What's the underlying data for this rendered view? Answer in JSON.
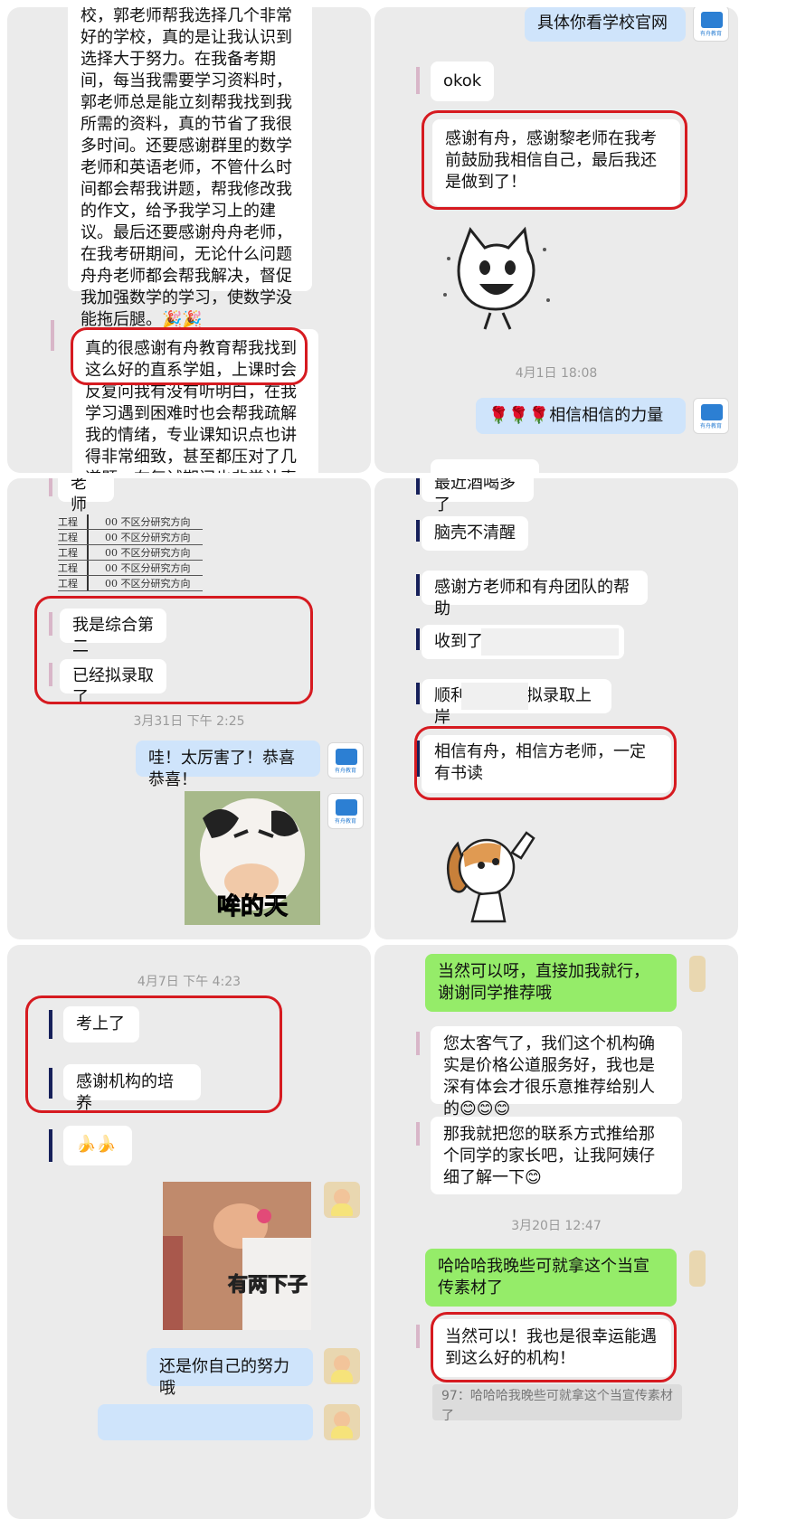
{
  "panels": {
    "p1": {
      "msg1": "校，郭老师帮我选择几个非常好的学校，真的是让我认识到选择大于努力。在我备考期间，每当我需要学习资料时，郭老师总是能立刻帮我找到我所需的资料，真的节省了我很多时间。还要感谢群里的数学老师和英语老师，不管什么时间都会帮我讲题，帮我修改我的作文，给予我学习上的建议。最后还要感谢舟舟老师，在我考研期间，无论什么问题舟舟老师都会帮我解决，督促我加强数学的学习，使数学没能拖后腿。🎉🎉",
      "msg2": "真的很感谢有舟教育帮我找到这么好的直系学姐，上课时会反复问我有没有听明白，在我学习遇到困难时也会帮我疏解我的情绪，专业课知识点也讲得非常细致，甚至都压对了几道题。在复试期间也非常认真"
    },
    "p2": {
      "msg1": "具体你看学校官网",
      "msg2": "okok",
      "msg3": "感谢有舟，感谢黎老师在我考前鼓励我相信自己，最后我还是做到了！",
      "time1": "4月1日  18:08",
      "msg4": "🌹🌹🌹相信相信的力量",
      "msg5": "最近酒喝多了"
    },
    "p3": {
      "msg0": "老师",
      "table": [
        {
          "c1": "工程",
          "c2": "00 不区分研究方向"
        },
        {
          "c1": "工程",
          "c2": "00 不区分研究方向"
        },
        {
          "c1": "工程",
          "c2": "00 不区分研究方向"
        },
        {
          "c1": "工程",
          "c2": "00 不区分研究方向"
        },
        {
          "c1": "工程",
          "c2": "00 不区分研究方向"
        }
      ],
      "msg1": "我是综合第二",
      "msg2": "已经拟录取了",
      "time1": "3月31日  下午 2:25",
      "msg3": "哇！太厉害了！恭喜恭喜！",
      "sticker_text": "哞的天"
    },
    "p4": {
      "msg1": "脑壳不清醒",
      "msg2": "感谢方老师和有舟团队的帮助",
      "msg3": "收到了",
      "msg4a": "顺利",
      "msg4b": "拟录取上岸",
      "msg5": "相信有舟，相信方老师，一定有书读"
    },
    "p5": {
      "time1": "4月7日  下午 4:23",
      "msg1": "考上了",
      "msg2": "感谢机构的培养",
      "msg3": "🍌🍌",
      "sticker_text": "有两下子",
      "msg4": "还是你自己的努力哦"
    },
    "p6": {
      "msg1": "当然可以呀，直接加我就行，谢谢同学推荐哦",
      "msg2": "您太客气了，我们这个机构确实是价格公道服务好，我也是深有体会才很乐意推荐给别人的😊😊😊",
      "msg3": "那我就把您的联系方式推给那个同学的家长吧，让我阿姨仔细了解一下😊",
      "time1": "3月20日  12:47",
      "msg4": "哈哈哈我晚些可就拿这个当宣传素材了",
      "msg5": "当然可以！我也是很幸运能遇到这么好的机构！",
      "quote": "97：哈哈哈我晚些可就拿这个当宣传素材了"
    }
  },
  "avatar_caption": "有舟教育",
  "colors": {
    "accent_red": "#d61a20",
    "self_green": "#95ec69",
    "self_blue": "#cfe4fb",
    "bubble_white": "#ffffff",
    "bg": "#ebebeb"
  }
}
